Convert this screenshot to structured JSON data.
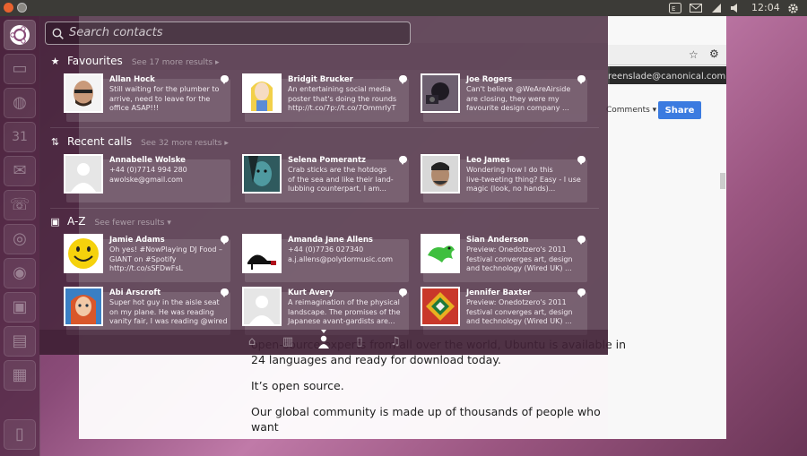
{
  "panel": {
    "clock": "12:04",
    "tray_icons": [
      "keyboard-layout-icon",
      "mail-icon",
      "network-icon",
      "volume-icon",
      "battery-icon",
      "gear-icon"
    ]
  },
  "search": {
    "placeholder": "Search contacts"
  },
  "browser": {
    "email": "reenslade@canonical.com",
    "comments_label": "Comments",
    "share_label": "Share",
    "content": [
      "open-source experts from all over the world, Ubuntu is available in 24 languages and ready for download today.",
      "It’s open source.",
      "Our global community is made up of thousands of people who want"
    ]
  },
  "sections": [
    {
      "title": "Favourites",
      "more": "See 17 more results",
      "contacts": [
        {
          "name": "Allan Hock",
          "text": "Still waiting for the plumber to\narrive, need to leave for the\noffice ASAP!!!"
        },
        {
          "name": "Bridgit Brucker",
          "text": "An entertaining social media\nposter that's doing the rounds\nhttp://t.co/7p://t.co/7OmmrIyT"
        },
        {
          "name": "Joe Rogers",
          "text": "Can't believe @WeAreAirside\nare closing, they were my\nfavourite design company ..."
        }
      ]
    },
    {
      "title": "Recent calls",
      "more": "See 32 more results",
      "contacts": [
        {
          "name": "Annabelle Wolske",
          "text": "+44 (0)7714 994 280\nawolske@gmail.com"
        },
        {
          "name": "Selena Pomerantz",
          "text": "Crab sticks are the hotdogs\nof the sea and like their land-\nlubbing counterpart, I am..."
        },
        {
          "name": "Leo James",
          "text": "Wondering how I do this\nlive-tweeting thing? Easy - I use\nmagic (look, no hands)..."
        }
      ]
    },
    {
      "title": "A-Z",
      "more": "See fewer results",
      "contacts": [
        {
          "name": "Jamie Adams",
          "text": "Oh yes! #NowPlaying DJ Food –\nGIANT on #Spotify\nhttp://t.co/sSFDwFsL"
        },
        {
          "name": "Amanda Jane Allens",
          "text": "+44 (0)7736 027340\na.j.allens@polydormusic.com"
        },
        {
          "name": "Sian Anderson",
          "text": "Preview: Onedotzero's 2011\nfestival converges art, design\nand technology (Wired UK) ..."
        },
        {
          "name": "Abi Arscroft",
          "text": "Super hot guy in the aisle seat\non my plane. He was reading\nvanity fair, I was reading @wired"
        },
        {
          "name": "Kurt Avery",
          "text": "A reimagination of the physical\nlandscape. The promises of the\nJapanese avant-gardists are..."
        },
        {
          "name": "Jennifer Baxter",
          "text": "Preview: Onedotzero's 2011\nfestival converges art, design\nand technology (Wired UK) ..."
        }
      ]
    }
  ],
  "lenses": [
    "home-lens-icon",
    "applications-lens-icon",
    "people-lens-icon",
    "files-lens-icon",
    "music-lens-icon"
  ],
  "colors": {
    "dash_tint": "#46263c",
    "accent_share": "#3b7be0",
    "close_button": "#e8622f"
  }
}
